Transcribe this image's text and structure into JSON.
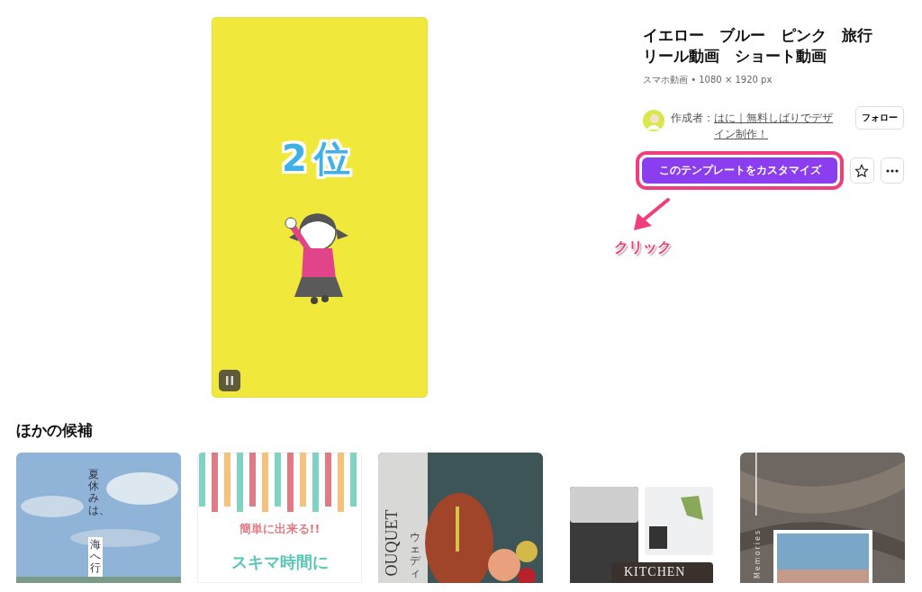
{
  "preview": {
    "headline": "2位"
  },
  "template": {
    "title_lines": [
      "イエロー　ブルー　ピンク　旅行",
      "リール動画　ショート動画"
    ],
    "meta": "スマホ動画 • 1080 × 1920 px",
    "byline_label": "作成者：",
    "creator": "はに｜無料しばりでデザイン制作！",
    "follow": "フォロー",
    "customize": "このテンプレートをカスタマイズ",
    "starred": false
  },
  "annotation": {
    "label": "クリック"
  },
  "section_title": "ほかの候補",
  "cards": [
    {
      "kind": "sky",
      "texts": [
        "夏休みは、",
        "海へ行"
      ]
    },
    {
      "kind": "stripes",
      "texts": [
        "簡単に出来る!!",
        "スキマ時間に"
      ]
    },
    {
      "kind": "flowers",
      "texts": [
        "OUQUET",
        "ウェディ"
      ]
    },
    {
      "kind": "kitchen",
      "texts": [
        "KITCHEN"
      ]
    },
    {
      "kind": "fabric",
      "texts": [
        "Memories"
      ]
    }
  ]
}
